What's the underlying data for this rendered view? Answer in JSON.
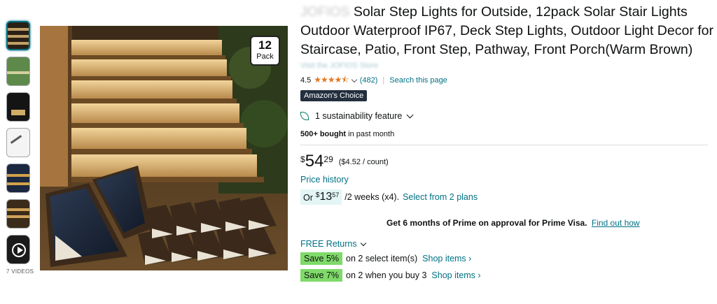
{
  "gallery": {
    "videos_label": "7 VIDEOS",
    "pack_badge": {
      "number": "12",
      "word": "Pack"
    }
  },
  "product": {
    "brand_blurred": "JOFIOS",
    "title": "Solar Step Lights for Outside, 12pack Solar Stair Lights Outdoor Waterproof IP67, Deck Step Lights, Outdoor Light Decor for Staircase, Patio, Front Step, Pathway, Front Porch(Warm Brown)",
    "store_link_blurred": "Visit the JOFIOS Store",
    "rating_value": "4.5",
    "rating_stars": "★★★★⯪",
    "rating_count": "(482)",
    "search_page": "Search this page",
    "choice_badge_prefix": "Amazon's",
    "choice_badge_suffix": " Choice",
    "sustainability": "1 sustainability feature",
    "bought_bold": "500+ bought",
    "bought_rest": " in past month"
  },
  "pricing": {
    "currency": "$",
    "whole": "54",
    "fraction": "29",
    "per_unit": "($4.52 / count)",
    "price_history": "Price history",
    "plan_or": "Or",
    "plan_currency": "$",
    "plan_whole": "13",
    "plan_fraction": "57",
    "plan_text": "/2 weeks (x4).",
    "plan_link": "Select from 2 plans"
  },
  "prime": {
    "offer": "Get 6 months of Prime on approval for Prime Visa.",
    "link": "Find out how"
  },
  "returns": {
    "label": "FREE Returns"
  },
  "promos": [
    {
      "badge": "Save 5%",
      "text": "on 2 select item(s)",
      "link": "Shop items ›"
    },
    {
      "badge": "Save 7%",
      "text": "on 2 when you buy 3",
      "link": "Shop items ›"
    }
  ],
  "colors": {
    "link": "#007185",
    "choice_bg": "#232f3e",
    "save_badge": "#7fda69",
    "star": "#de7921"
  }
}
